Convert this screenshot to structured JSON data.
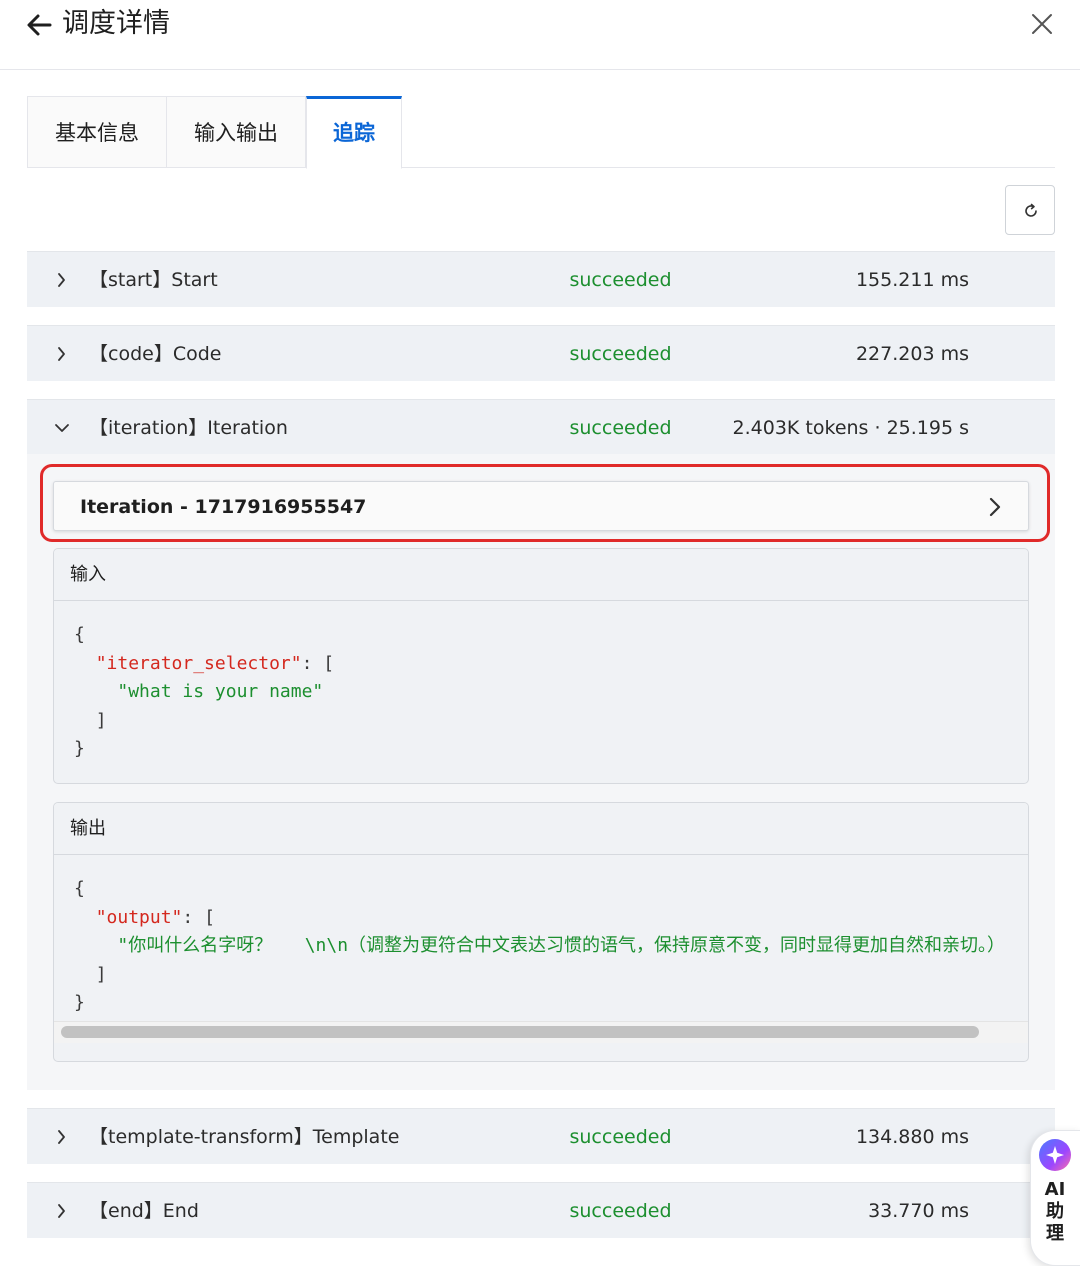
{
  "header": {
    "title": "调度详情",
    "back_icon": "arrow-left-icon",
    "close_icon": "close-icon"
  },
  "tabs": [
    {
      "label": "基本信息",
      "active": false
    },
    {
      "label": "输入输出",
      "active": false
    },
    {
      "label": "追踪",
      "active": true
    }
  ],
  "toolbar": {
    "refresh_icon": "refresh-icon"
  },
  "colors": {
    "accent": "#0b66d6",
    "success": "#1c8f2f",
    "json_key": "#d4281e",
    "highlight": "#e02a2a"
  },
  "trace": [
    {
      "name": "【start】Start",
      "status": "succeeded",
      "metric": "155.211 ms",
      "expanded": false
    },
    {
      "name": "【code】Code",
      "status": "succeeded",
      "metric": "227.203 ms",
      "expanded": false
    },
    {
      "name": "【iteration】Iteration",
      "status": "succeeded",
      "metric": "2.403K tokens · 25.195 s",
      "expanded": true
    },
    {
      "name": "【template-transform】Template",
      "status": "succeeded",
      "metric": "134.880 ms",
      "expanded": false
    },
    {
      "name": "【end】End",
      "status": "succeeded",
      "metric": "33.770 ms",
      "expanded": false
    }
  ],
  "iteration": {
    "title": "Iteration - 1717916955547",
    "input": {
      "label": "输入",
      "open": "{",
      "key": "\"iterator_selector\"",
      "colon_bracket": ": [",
      "value": "\"what is your name\"",
      "close_bracket": "]",
      "close": "}"
    },
    "output": {
      "label": "输出",
      "open": "{",
      "key": "\"output\"",
      "colon_bracket": ": [",
      "value": "\"你叫什么名字呀？   \\n\\n（调整为更符合中文表达习惯的语气，保持原意不变，同时显得更加自然和亲切。）",
      "close_bracket": "]",
      "close": "}"
    }
  },
  "ai_widget": {
    "label": "AI助理",
    "l1": "AI",
    "l2": "助",
    "l3": "理"
  }
}
